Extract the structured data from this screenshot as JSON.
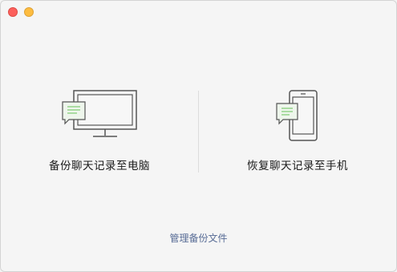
{
  "window": {
    "controls": [
      "close",
      "minimize"
    ]
  },
  "options": [
    {
      "label": "备份聊天记录至电脑",
      "icon": "monitor-chat-icon"
    },
    {
      "label": "恢复聊天记录至手机",
      "icon": "phone-chat-icon"
    }
  ],
  "footer": {
    "manage_label": "管理备份文件"
  },
  "colors": {
    "link": "#576b95",
    "bubble": "#e8f3e6",
    "bubble_lines": "#8fd48a"
  }
}
